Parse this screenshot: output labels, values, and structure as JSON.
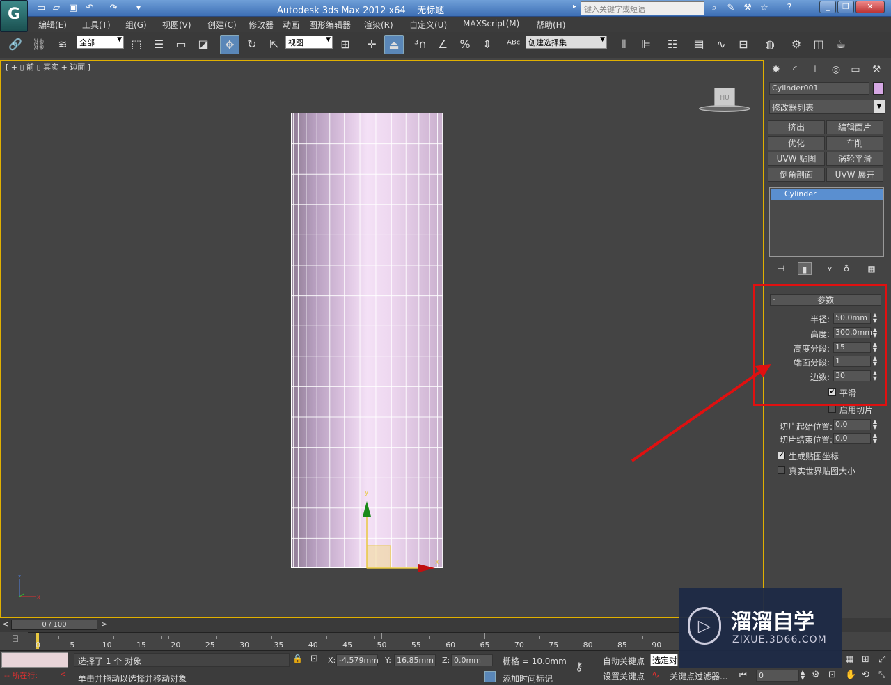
{
  "app": {
    "title": "Autodesk 3ds Max  2012 x64",
    "doc_title": "无标题",
    "logo_glyph": "G",
    "search_placeholder": "键入关键字或短语"
  },
  "menu": [
    "编辑(E)",
    "工具(T)",
    "组(G)",
    "视图(V)",
    "创建(C)",
    "修改器",
    "动画",
    "图形编辑器",
    "渲染(R)",
    "自定义(U)",
    "MAXScript(M)",
    "帮助(H)"
  ],
  "toolbar": {
    "selection_filter": "全部",
    "ref_coord": "视图",
    "named_selection": "创建选择集"
  },
  "viewport": {
    "label": "[ + ▯ 前 ▯ 真实 + 边面 ]",
    "viewcube_label": "HU"
  },
  "command_panel": {
    "object_name": "Cylinder001",
    "object_color": "#d6a8e4",
    "modifier_list": "修改器列表",
    "modifier_buttons": [
      "挤出",
      "编辑面片",
      "优化",
      "车削",
      "UVW 贴图",
      "涡轮平滑",
      "倒角剖面",
      "UVW 展开"
    ],
    "stack_item": "Cylinder",
    "rollout_title": "参数",
    "rollout_minus": "-",
    "params": [
      {
        "label": "半径:",
        "value": "50.0mm"
      },
      {
        "label": "高度:",
        "value": "300.0mm"
      },
      {
        "label": "高度分段:",
        "value": "15"
      },
      {
        "label": "端面分段:",
        "value": "1"
      },
      {
        "label": "边数:",
        "value": "30"
      }
    ],
    "smooth_label": "平滑",
    "slice_label": "启用切片",
    "slice_from_label": "切片起始位置:",
    "slice_from_value": "0.0",
    "slice_to_label": "切片结束位置:",
    "slice_to_value": "0.0",
    "gen_map_label": "生成贴图坐标",
    "real_world_label": "真实世界贴图大小"
  },
  "timeline": {
    "slider": "0 / 100",
    "ticks": [
      "0",
      "5",
      "10",
      "15",
      "20",
      "25",
      "30",
      "35",
      "40",
      "45",
      "50",
      "55",
      "60",
      "65",
      "70",
      "75",
      "80",
      "85",
      "90"
    ]
  },
  "status": {
    "selected": "选择了 1 个 对象",
    "prompt": "单击并拖动以选择并移动对象",
    "running": "所在行:",
    "x_label": "X:",
    "x": "-4.579mm",
    "y_label": "Y:",
    "y": "16.85mm",
    "z_label": "Z:",
    "z": "0.0mm",
    "grid": "栅格 = 10.0mm",
    "auto_key": "自动关键点",
    "set_key": "设置关键点",
    "key_mode": "选定对",
    "key_filters": "关键点过滤器...",
    "add_time_tag": "添加时间标记",
    "frame": "0"
  },
  "watermark": {
    "title": "溜溜自学",
    "sub": "ZIXUE.3D66.COM"
  }
}
